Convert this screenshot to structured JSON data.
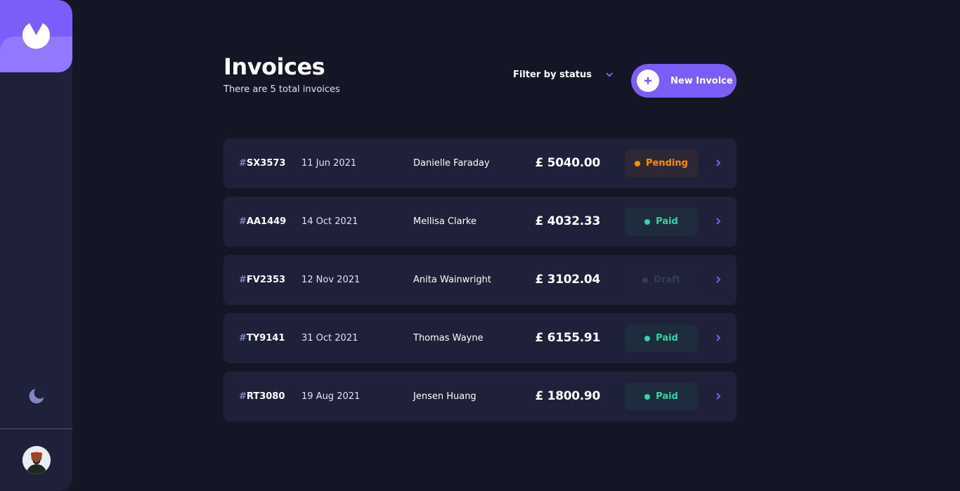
{
  "header": {
    "title": "Invoices",
    "subtitle": "There are 5 total invoices",
    "filter_label": "Filter by status",
    "new_invoice_label": "New Invoice"
  },
  "colors": {
    "accent": "#7c5dfa",
    "background": "#141625",
    "card": "#1e2139",
    "pending": "#ff8f00",
    "paid": "#33d69f",
    "draft": "#373b53"
  },
  "icons": {
    "logo": "logo-icon",
    "theme": "moon-icon",
    "filter": "chevron-down-icon",
    "add": "plus-icon",
    "row_arrow": "chevron-right-icon"
  },
  "invoices": [
    {
      "hash": "#",
      "id": "SX3573",
      "date": "11 Jun 2021",
      "client": "Danielle Faraday",
      "amount": "£ 5040.00",
      "status": "Pending"
    },
    {
      "hash": "#",
      "id": "AA1449",
      "date": "14 Oct 2021",
      "client": "Mellisa Clarke",
      "amount": "£ 4032.33",
      "status": "Paid"
    },
    {
      "hash": "#",
      "id": "FV2353",
      "date": "12 Nov 2021",
      "client": "Anita Wainwright",
      "amount": "£ 3102.04",
      "status": "Draft"
    },
    {
      "hash": "#",
      "id": "TY9141",
      "date": "31 Oct 2021",
      "client": "Thomas Wayne",
      "amount": "£ 6155.91",
      "status": "Paid"
    },
    {
      "hash": "#",
      "id": "RT3080",
      "date": "19 Aug 2021",
      "client": "Jensen Huang",
      "amount": "£ 1800.90",
      "status": "Paid"
    }
  ]
}
